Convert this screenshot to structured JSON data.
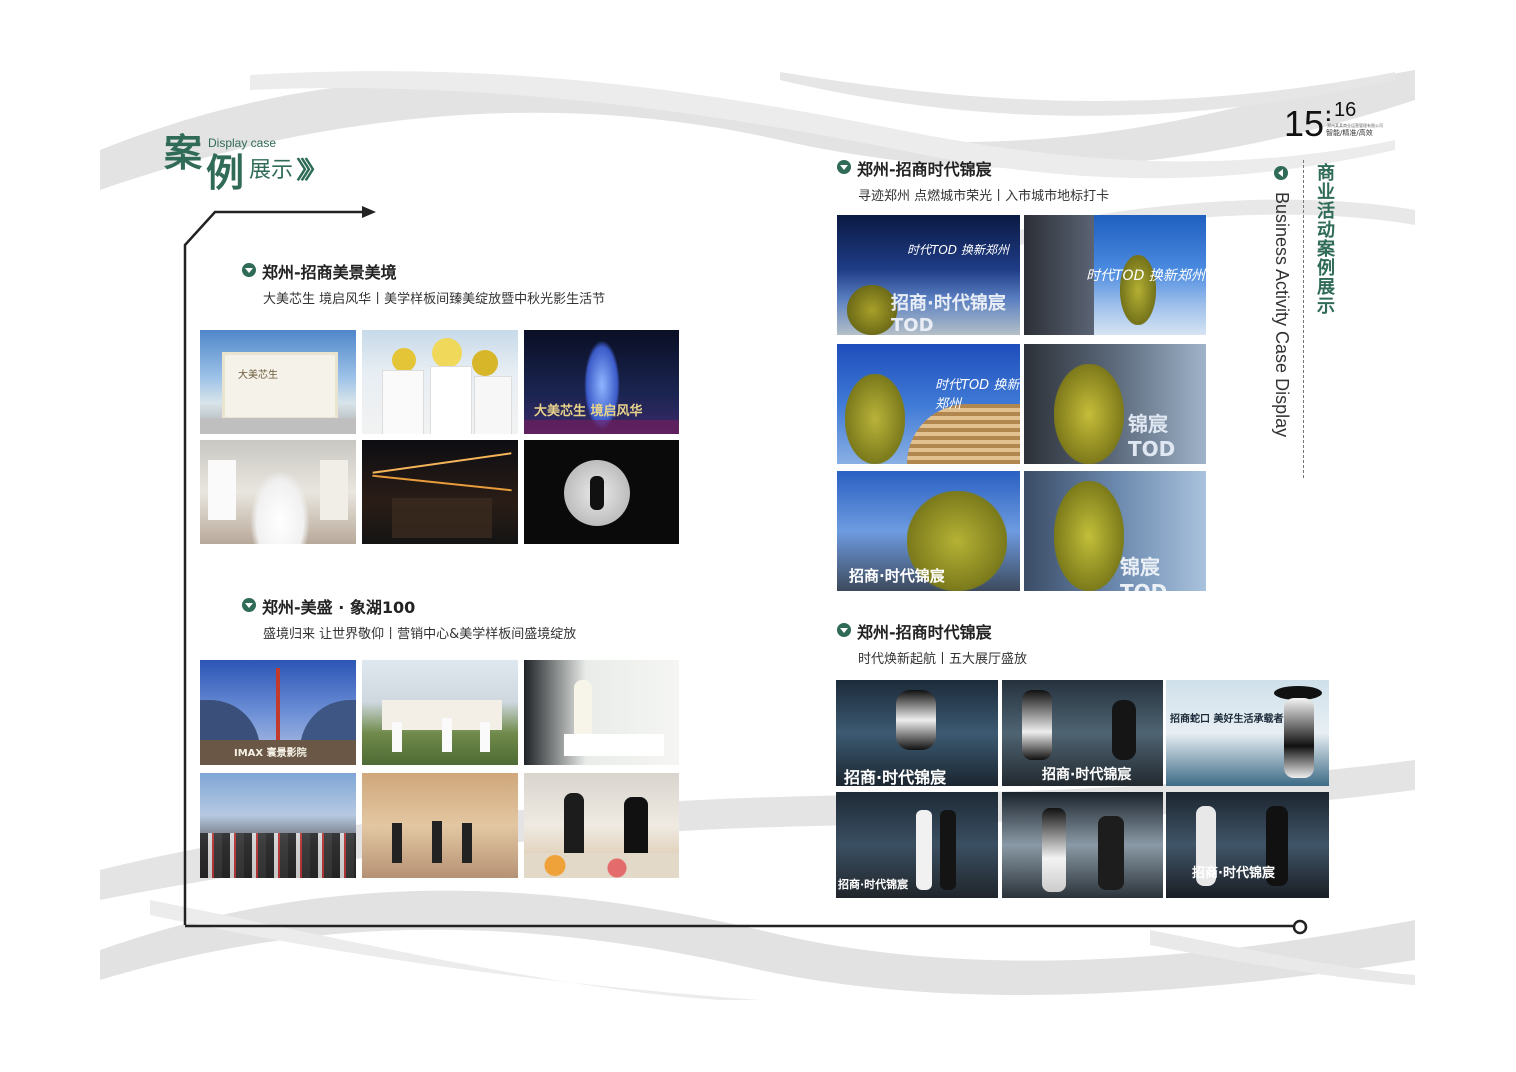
{
  "header": {
    "char1": "案",
    "char2": "例",
    "en": "Display case",
    "cn2": "展示",
    "chevrons": "〉〉〉"
  },
  "page_number": {
    "main": "15",
    "small": "16",
    "separator": ":",
    "tag": "智能/精准/高效",
    "company": "郑州某某商业运营管理有限公司"
  },
  "vertical": {
    "cn": "商业活动案例展示",
    "en": "Business Activity Case Display"
  },
  "sections": [
    {
      "title": "郑州-招商美景美境",
      "subtitle": "大美芯生 境启风华丨美学样板间臻美绽放暨中秋光影生活节"
    },
    {
      "title": "郑州-美盛 · 象湖100",
      "subtitle": "盛境归来 让世界敬仰丨营销中心&美学样板间盛境绽放"
    },
    {
      "title": "郑州-招商时代锦宸",
      "subtitle": "寻迹郑州 点燃城市荣光丨入市城市地标打卡"
    },
    {
      "title": "郑州-招商时代锦宸",
      "subtitle": "时代焕新起航丨五大展厅盛放"
    }
  ],
  "photo_text": {
    "imax": "IMAX 寰景影院",
    "tod": "招商·时代锦宸TOD",
    "tod_short": "锦宸TOD",
    "zhengzhou": "时代TOD 换新郑州",
    "shidai": "招商·时代锦宸",
    "life": "招商蛇口 美好生活承载者",
    "meijing": "大美芯生",
    "meijing2": "大美芯生 境启风华"
  },
  "colors": {
    "accent": "#2f6b57",
    "wave": "#e2e2e2",
    "line": "#222222"
  }
}
